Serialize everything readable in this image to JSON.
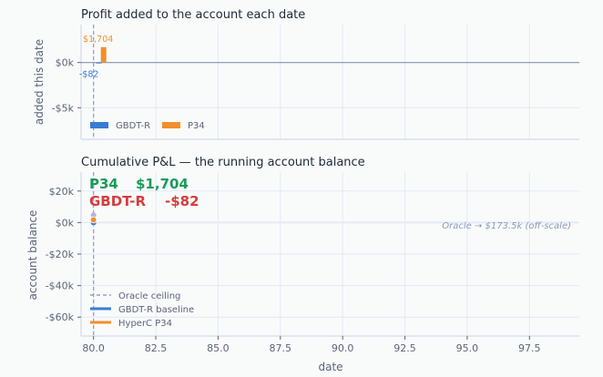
{
  "chart_data": [
    {
      "type": "bar",
      "title": "Profit added to the account each date",
      "xlabel": "",
      "ylabel": "added this date",
      "xlim": [
        79.5,
        99.5
      ],
      "ylim": [
        -8500,
        4200
      ],
      "yticks": [
        {
          "v": 0,
          "label": "$0k"
        },
        {
          "v": -5000,
          "label": "-$5k"
        }
      ],
      "series": [
        {
          "name": "GBDT-R",
          "color": "#3a7bd5",
          "x": [
            80.0
          ],
          "values": [
            -82
          ],
          "label_texts": [
            "-$82"
          ]
        },
        {
          "name": "P34",
          "color": "#f28e2b",
          "x": [
            80.0
          ],
          "values": [
            1704
          ],
          "label_texts": [
            "$1,704"
          ]
        }
      ],
      "legend": "lower-left",
      "grid": true
    },
    {
      "type": "line",
      "title": "Cumulative P&L — the running account balance",
      "xlabel": "date",
      "ylabel": "account balance",
      "xlim": [
        79.5,
        99.5
      ],
      "ylim": [
        -72000,
        32000
      ],
      "xticks": [
        "80.0",
        "82.5",
        "85.0",
        "87.5",
        "90.0",
        "92.5",
        "95.0",
        "97.5"
      ],
      "yticks": [
        {
          "v": 20000,
          "label": "$20k"
        },
        {
          "v": 0,
          "label": "$0k"
        },
        {
          "v": -20000,
          "label": "-$20k"
        },
        {
          "v": -40000,
          "label": "-$40k"
        },
        {
          "v": -60000,
          "label": "-$60k"
        }
      ],
      "series": [
        {
          "name": "Oracle ceiling",
          "color": "#8fa3c8",
          "x": [
            80.0
          ],
          "values": [
            173500
          ]
        },
        {
          "name": "GBDT-R baseline",
          "color": "#3a7bd5",
          "x": [
            80.0
          ],
          "values": [
            -82
          ]
        },
        {
          "name": "HyperC P34",
          "color": "#f28e2b",
          "x": [
            80.0
          ],
          "values": [
            1704
          ]
        }
      ],
      "summary": [
        {
          "name": "P34",
          "value": "$1,704",
          "color": "#1a9a5b"
        },
        {
          "name": "GBDT-R",
          "value": "-$82",
          "color": "#d63c3c"
        }
      ],
      "annotation": "Oracle → $173.5k (off-scale)",
      "legend": "lower-left",
      "grid": true
    }
  ]
}
